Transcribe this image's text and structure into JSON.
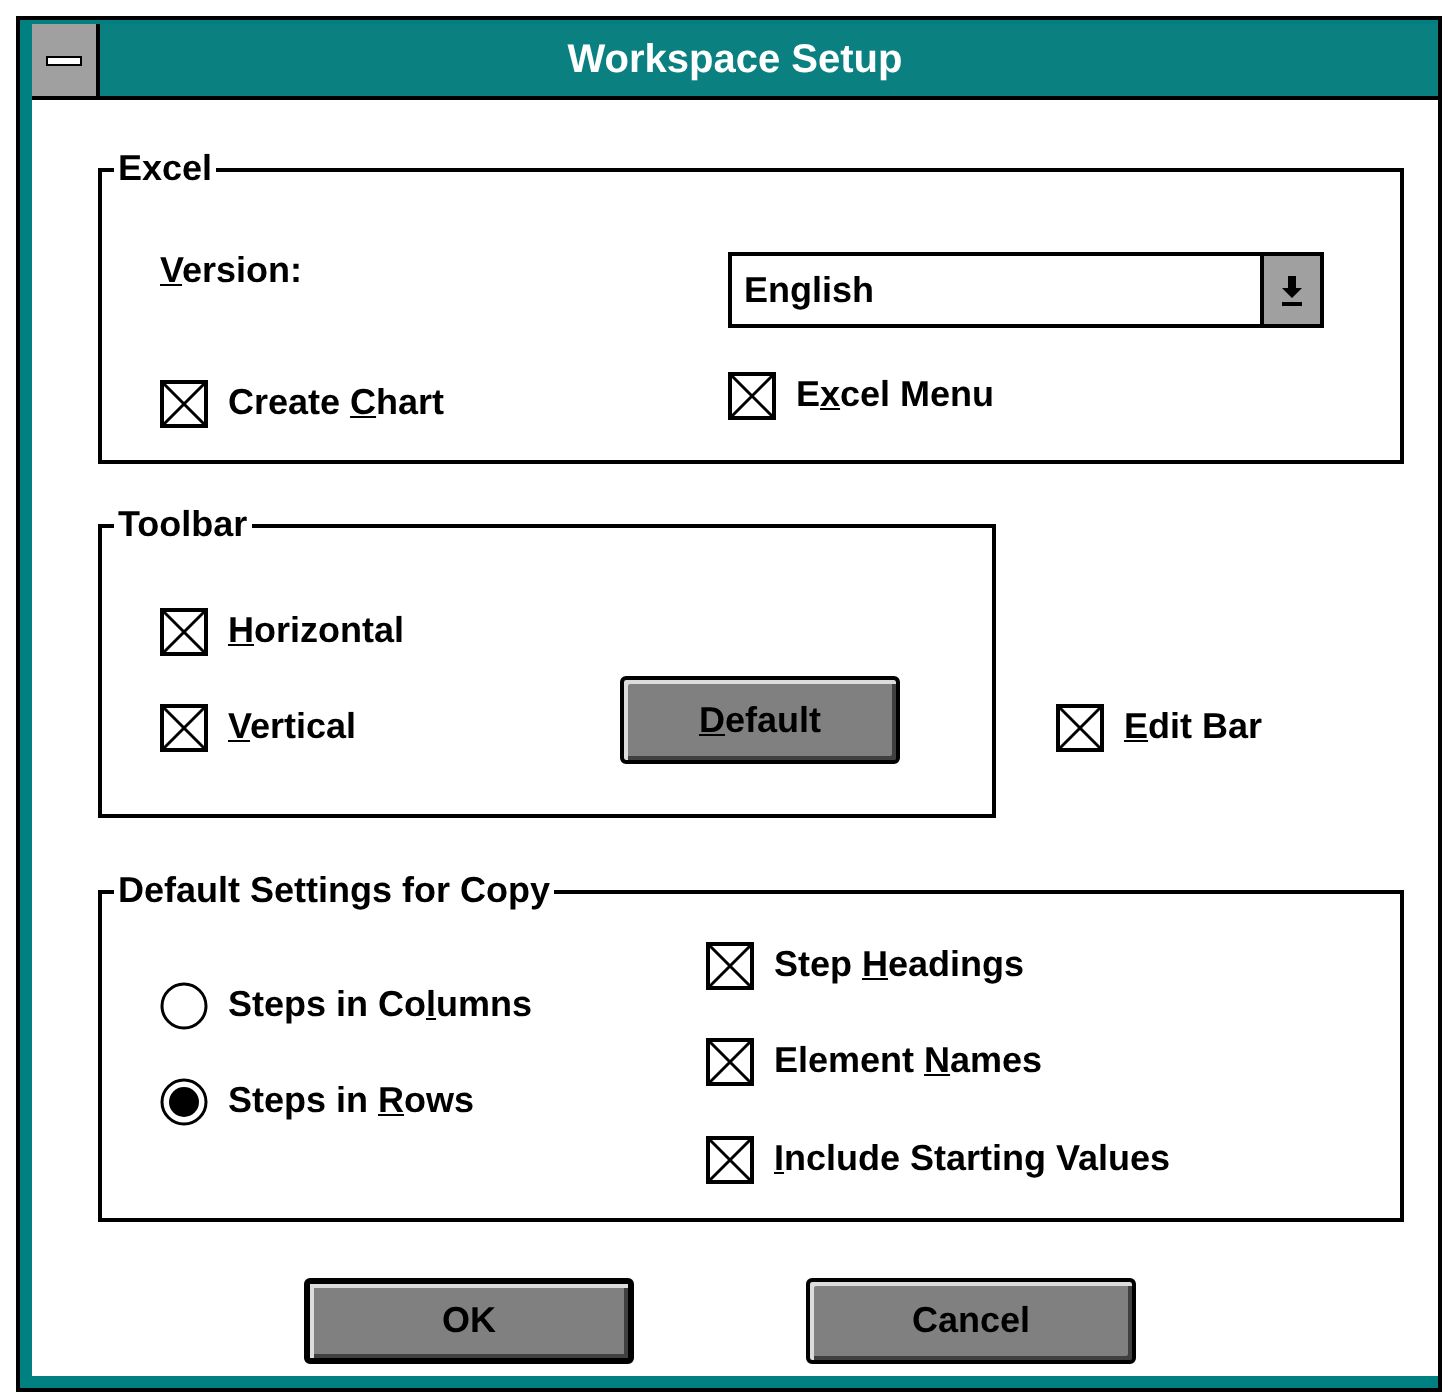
{
  "window": {
    "title": "Workspace Setup"
  },
  "excel": {
    "title": "Excel",
    "version_label": {
      "hotkey": "V",
      "suffix": "ersion:"
    },
    "version_value": "English",
    "checkboxes": [
      {
        "prefix": "Create ",
        "hotkey": "C",
        "suffix": "hart",
        "checked": true
      },
      {
        "prefix": "E",
        "hotkey": "x",
        "suffix": "cel Menu",
        "checked": true
      }
    ]
  },
  "toolbar": {
    "title": "Toolbar",
    "checkboxes": [
      {
        "hotkey": "H",
        "suffix": "orizontal",
        "checked": true
      },
      {
        "hotkey": "V",
        "suffix": "ertical",
        "checked": true
      }
    ],
    "default_button": {
      "hotkey": "D",
      "suffix": "efault"
    }
  },
  "edit_bar": {
    "hotkey": "E",
    "suffix": "dit Bar",
    "checked": true
  },
  "copy": {
    "title": "Default Settings for Copy",
    "radios": [
      {
        "prefix": "Steps in Co",
        "hotkey": "l",
        "suffix": "umns",
        "selected": false
      },
      {
        "prefix": "Steps in ",
        "hotkey": "R",
        "suffix": "ows",
        "selected": true
      }
    ],
    "checkboxes": [
      {
        "prefix": "Step ",
        "hotkey": "H",
        "suffix": "eadings",
        "checked": true
      },
      {
        "prefix": "Element ",
        "hotkey": "N",
        "suffix": "ames",
        "checked": true
      },
      {
        "hotkey": "I",
        "suffix": "nclude Starting Values",
        "checked": true
      }
    ]
  },
  "buttons": [
    {
      "label": "OK",
      "default": true
    },
    {
      "label": "Cancel",
      "default": false
    }
  ]
}
